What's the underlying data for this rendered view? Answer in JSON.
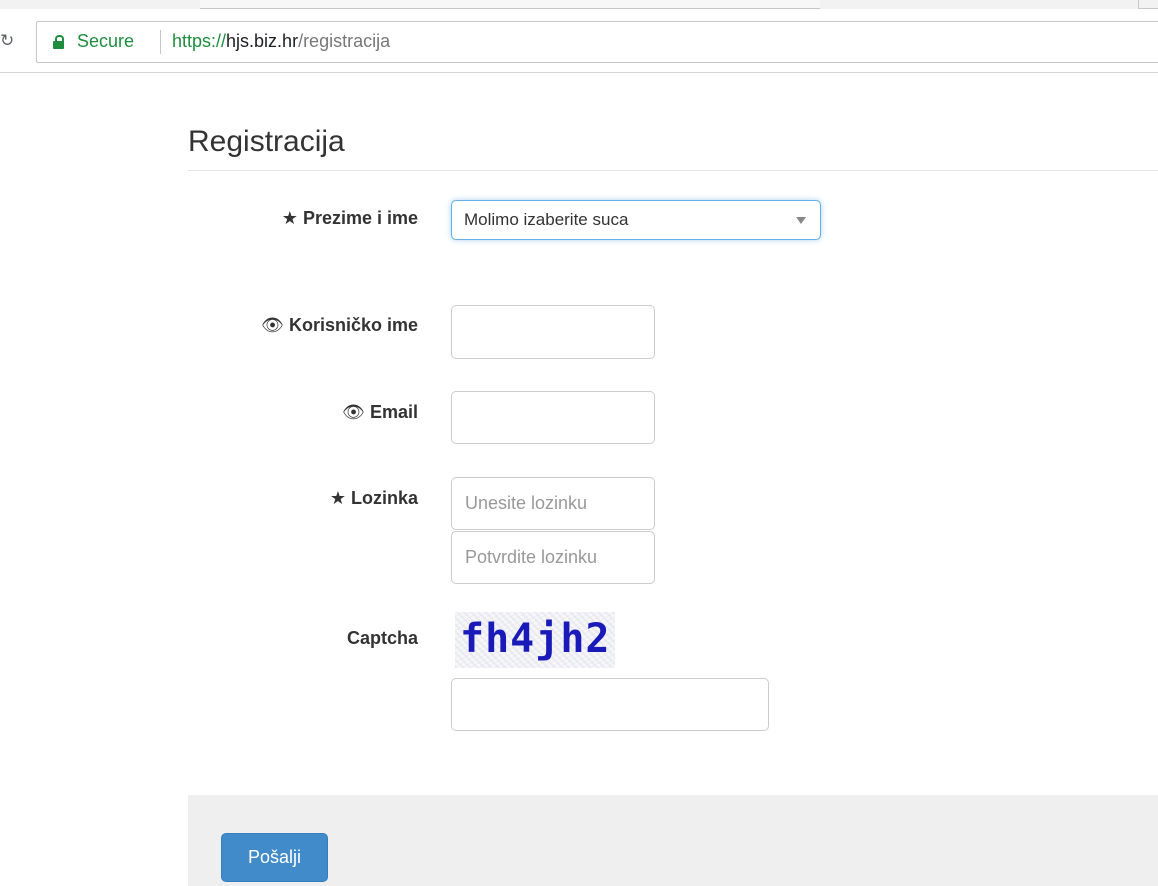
{
  "browser": {
    "security_label": "Secure",
    "url_scheme": "https://",
    "url_host": "hjs.biz.hr",
    "url_path": "/registracija"
  },
  "page": {
    "title": "Registracija"
  },
  "form": {
    "name_label": "Prezime i ime",
    "name_select_value": "Molimo izaberite suca",
    "username_label": "Korisničko ime",
    "username_value": "",
    "email_label": "Email",
    "email_value": "",
    "password_label": "Lozinka",
    "password_placeholder": "Unesite lozinku",
    "password_confirm_placeholder": "Potvrdite lozinku",
    "captcha_label": "Captcha",
    "captcha_text": "fh4jh2",
    "captcha_input_value": "",
    "submit_label": "Pošalji"
  },
  "icons": {
    "required": "star-icon",
    "visible": "eye-icon",
    "lock": "lock-icon",
    "reload": "reload-icon",
    "dropdown": "chevron-down-icon"
  },
  "colors": {
    "secure_green": "#1e8e3e",
    "primary_button": "#428bca",
    "focus_border": "#66afe9",
    "captcha_ink": "#1a1ab8"
  }
}
